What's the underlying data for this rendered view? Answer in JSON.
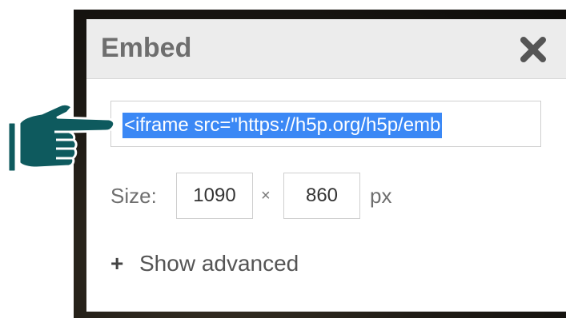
{
  "dialog": {
    "title": "Embed",
    "close_icon": "close-icon",
    "embed_code": "<iframe src=\"https://h5p.org/h5p/emb",
    "size": {
      "label": "Size:",
      "width": "1090",
      "times": "×",
      "height": "860",
      "unit": "px"
    },
    "advanced": {
      "icon": "plus-icon",
      "label": "Show advanced"
    }
  },
  "pointer": {
    "icon": "pointing-hand-icon",
    "color": "#0e5a5e"
  },
  "colors": {
    "selection": "#3b88f5",
    "header_bg": "#ececec",
    "title_text": "#6e6e6e"
  }
}
